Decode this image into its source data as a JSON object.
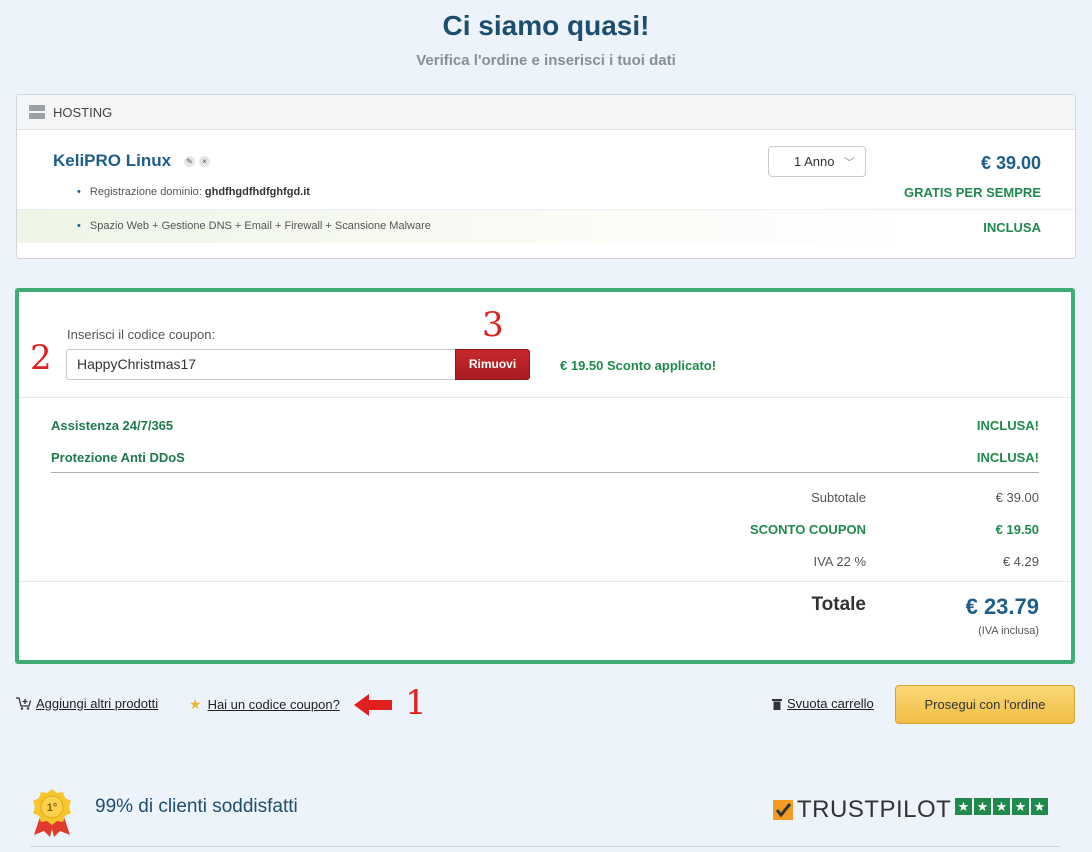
{
  "header": {
    "title": "Ci siamo quasi!",
    "subtitle": "Verifica l'ordine e inserisci i tuoi dati"
  },
  "hosting": {
    "section_label": "HOSTING",
    "product_name": "KeliPRO Linux",
    "period": "1 Anno",
    "price": "€ 39.00",
    "domain_label": "Registrazione dominio:",
    "domain_name": "ghdfhgdfhdfghfgd.it",
    "domain_price": "GRATIS PER SEMPRE",
    "features": "Spazio Web + Gestione DNS + Email + Firewall + Scansione Malware",
    "features_price": "INCLUSA"
  },
  "coupon": {
    "label": "Inserisci il codice coupon:",
    "value": "HappyChristmas17",
    "remove_label": "Rimuovi",
    "applied_message": "€ 19.50 Sconto applicato!"
  },
  "services": [
    {
      "name": "Assistenza 24/7/365",
      "value": "INCLUSA!"
    },
    {
      "name": "Protezione Anti DDoS",
      "value": "INCLUSA!"
    }
  ],
  "totals": {
    "subtotal_label": "Subtotale",
    "subtotal_value": "€ 39.00",
    "coupon_label": "SCONTO COUPON",
    "coupon_value": "€ 19.50",
    "vat_label": "IVA 22 %",
    "vat_value": "€ 4.29",
    "total_label": "Totale",
    "total_value": "€ 23.79",
    "total_note": "(IVA inclusa)"
  },
  "annotations": {
    "one": "1",
    "two": "2",
    "three": "3"
  },
  "actions": {
    "add_products": "Aggiungi altri prodotti",
    "have_coupon": "Hai un codice coupon?",
    "empty_cart": "Svuota carrello",
    "continue": "Prosegui con l'ordine"
  },
  "footer": {
    "satisfaction": "99% di clienti soddisfatti",
    "badge_text": "1°",
    "trustpilot": "TRUSTPILOT",
    "trustpilot_stars": 5
  },
  "colors": {
    "accent_green": "#3fae74",
    "brand_blue": "#1d5e8a",
    "remove_red": "#c6282d",
    "continue_yellow": "#f4c95a",
    "annotation_red": "#e0201e"
  }
}
